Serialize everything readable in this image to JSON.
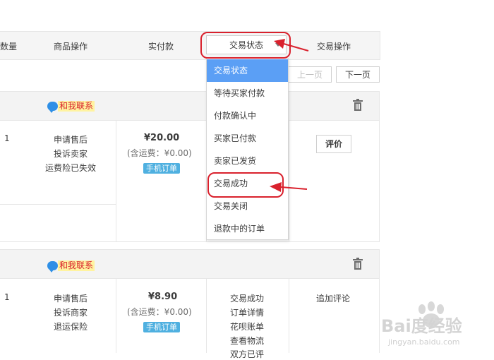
{
  "table_header": {
    "quantity": "数量",
    "item_actions": "商品操作",
    "paid": "实付款",
    "status_select_value": "交易状态",
    "trade_actions": "交易操作"
  },
  "pager": {
    "prev": "上一页",
    "next": "下一页"
  },
  "status_dropdown": {
    "options": [
      "交易状态",
      "等待买家付款",
      "付款确认中",
      "买家已付款",
      "卖家已发货",
      "交易成功",
      "交易关闭",
      "退款中的订单"
    ],
    "selected_index": 0,
    "highlighted_option": "交易成功"
  },
  "orders": [
    {
      "contact_label": "和我联系",
      "quantity": "1",
      "item_actions": [
        "申请售后",
        "投诉卖家",
        "运费险已失效"
      ],
      "price": "¥20.00",
      "shipping": "(含运费：¥0.00)",
      "badge": "手机订单",
      "action_button": "评价"
    },
    {
      "contact_label": "和我联系",
      "quantity": "1",
      "item_actions": [
        "申请售后",
        "投诉商家",
        "退运保险"
      ],
      "price": "¥8.90",
      "shipping": "(含运费：¥0.00)",
      "badge": "手机订单",
      "status_links": [
        "交易成功",
        "订单详情",
        "花呗账单",
        "查看物流",
        "双方已评"
      ],
      "trade_action": "追加评论"
    }
  ],
  "watermark": {
    "brand": "Bai度经验",
    "url": "jingyan.baidu.com"
  },
  "colors": {
    "annotation_red": "#d9212d",
    "dropdown_highlight": "#5b9ff5",
    "badge_blue": "#4fb0e0"
  }
}
